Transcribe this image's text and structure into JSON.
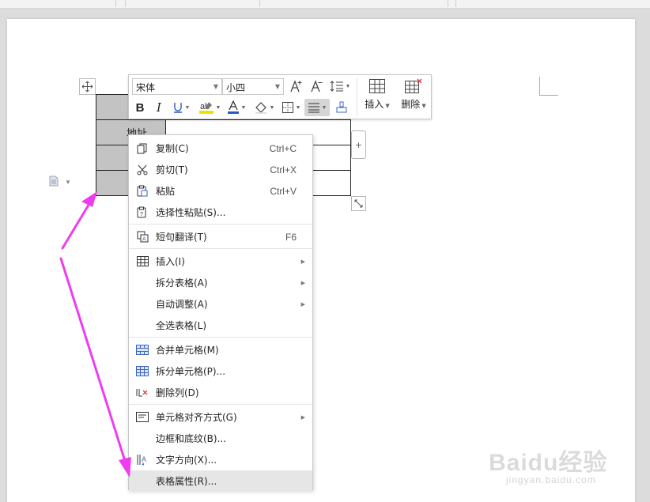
{
  "toolbar": {
    "font_name": "宋体",
    "font_size": "小四",
    "insert_label": "插入",
    "delete_label": "删除",
    "font_color": "#2b58c8",
    "highlight_color": "#f2e100"
  },
  "table": {
    "rows": [
      {
        "a": "",
        "b": ""
      },
      {
        "a": "地址",
        "b": ""
      },
      {
        "a": "",
        "b": ""
      },
      {
        "a": "",
        "b": ""
      }
    ]
  },
  "context_menu": {
    "items": [
      {
        "label": "复制(C)",
        "shortcut": "Ctrl+C",
        "icon": "copy-icon"
      },
      {
        "label": "剪切(T)",
        "shortcut": "Ctrl+X",
        "icon": "cut-icon"
      },
      {
        "label": "粘贴",
        "shortcut": "Ctrl+V",
        "icon": "paste-icon"
      },
      {
        "label": "选择性粘贴(S)...",
        "shortcut": "",
        "icon": "paste-special-icon"
      },
      {
        "label": "短句翻译(T)",
        "shortcut": "F6",
        "icon": "translate-icon"
      },
      {
        "label": "插入(I)",
        "shortcut": "",
        "icon": "table-insert-icon",
        "submenu": true
      },
      {
        "label": "拆分表格(A)",
        "shortcut": "",
        "icon": "",
        "submenu": true
      },
      {
        "label": "自动调整(A)",
        "shortcut": "",
        "icon": "",
        "submenu": true
      },
      {
        "label": "全选表格(L)",
        "shortcut": "",
        "icon": ""
      },
      {
        "label": "合并单元格(M)",
        "shortcut": "",
        "icon": "merge-cells-icon"
      },
      {
        "label": "拆分单元格(P)...",
        "shortcut": "",
        "icon": "split-cells-icon"
      },
      {
        "label": "删除列(D)",
        "shortcut": "",
        "icon": "delete-column-icon"
      },
      {
        "label": "单元格对齐方式(G)",
        "shortcut": "",
        "icon": "cell-align-icon",
        "submenu": true
      },
      {
        "label": "边框和底纹(B)...",
        "shortcut": "",
        "icon": ""
      },
      {
        "label": "文字方向(X)...",
        "shortcut": "",
        "icon": "text-direction-icon"
      },
      {
        "label": "表格属性(R)...",
        "shortcut": "",
        "icon": "",
        "highlighted": true
      }
    ]
  },
  "watermark": {
    "brand": "Baidu经验",
    "url": "jingyan.baidu.com"
  },
  "annotation_color": "#f03cf0"
}
